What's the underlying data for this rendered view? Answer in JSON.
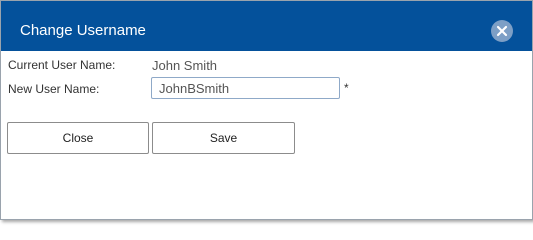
{
  "dialog": {
    "title": "Change Username",
    "close_icon": "close-circle-icon"
  },
  "form": {
    "current_label": "Current User Name:",
    "current_value": "John Smith",
    "new_label": "New User Name:",
    "new_value": "JohnBSmith",
    "required_marker": "*"
  },
  "buttons": {
    "close_label": "Close",
    "save_label": "Save"
  },
  "colors": {
    "titlebar": "#04519b",
    "close_icon_bg": "#7d9fc6"
  }
}
